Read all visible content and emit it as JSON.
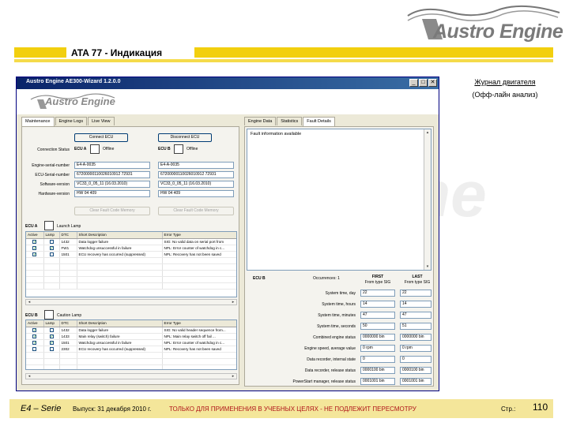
{
  "brand": {
    "logo": "Austro Engine",
    "watermark": "ne"
  },
  "page_title": "ATA 77 - Индикация",
  "side_note": {
    "line1": "Журнал двигателя",
    "line2": "(Офф-лайн анализ)"
  },
  "footer": {
    "series": "E4 – Serie",
    "issue": "Выпуск: 31 декабря 2010 г.",
    "warning": "ТОЛЬКО ДЛЯ ПРИМЕНЕНИЯ В УЧЕБНЫХ ЦЕЛЯХ - НЕ ПОДЛЕЖИТ ПЕРЕСМОТРУ",
    "page_label": "Стр.:",
    "page_number": "110"
  },
  "window": {
    "title": "Austro Engine AE300-Wizard 1.2.0.0",
    "banner_logo": "Austro Engine",
    "controls": {
      "minimize": "_",
      "maximize": "□",
      "close": "✕"
    },
    "left_tabs": [
      "Maintenance",
      "Engine Logs",
      "Live View"
    ],
    "right_tabs": [
      "Engine Data",
      "Statistics",
      "Fault Details"
    ],
    "connect_a": "Connect ECU",
    "connect_b": "Disconnect ECU",
    "connection_status_label": "Connection Status",
    "ecu_a": {
      "name": "ECU A",
      "status": "Offline"
    },
    "ecu_b": {
      "name": "ECU B",
      "status": "Offline"
    },
    "fields": [
      {
        "label": "Engine-serial-number",
        "a": "E4-A-0035",
        "b": "E4-A-0035"
      },
      {
        "label": "ECU-Serial-number",
        "a": "67200000110026010912 72931",
        "b": "67200000110026010912 72931"
      },
      {
        "label": "Software-version",
        "a": "VC33_0_05_11 (16.03.2010)",
        "b": "VC33_0_05_11 (16.03.2010)"
      },
      {
        "label": "Hardware-version",
        "a": "HW 04 409",
        "b": "HW 04 409"
      }
    ],
    "clear_a": "Clear Fault Code Memory",
    "clear_b": "Clear Fault Code Memory",
    "launch_lamp": {
      "ecu": "ECU A",
      "label": "Launch Lamp"
    },
    "caution_lamp": {
      "ecu": "ECU B",
      "label": "Caution Lamp"
    },
    "fault_columns": [
      "Active",
      "Lamp",
      "DTC",
      "Short Description",
      "Error Type"
    ],
    "faults_top": [
      {
        "active": true,
        "lamp": false,
        "dtc": "1432",
        "desc": "Data logger failure",
        "err": "SIG: No valid data on serial port from"
      },
      {
        "active": true,
        "lamp": true,
        "dtc": "FW1",
        "desc": "Watchdog unsuccessful in failure",
        "err": "NPL: Error counter of watchdog in c..."
      },
      {
        "active": true,
        "lamp": false,
        "dtc": "1501",
        "desc": "ECU recovery has occurred (suppressed)",
        "err": "NPL: Recovery has not been saved"
      }
    ],
    "faults_bottom": [
      {
        "active": true,
        "lamp": false,
        "dtc": "1432",
        "desc": "Data logger failure",
        "err": "SIG: No valid header sequence from..."
      },
      {
        "active": true,
        "lamp": true,
        "dtc": "1433",
        "desc": "Main relay (switch) failure",
        "err": "NPL: Main relay switch off fail ..."
      },
      {
        "active": true,
        "lamp": true,
        "dtc": "1501",
        "desc": "Watchdog unsuccessful in failure",
        "err": "NPL: Error counter of watchdog in c..."
      },
      {
        "active": false,
        "lamp": false,
        "dtc": "2302",
        "desc": "ECU recovery has occurred (suppressed)",
        "err": "NPL: Recovery has not been saved"
      }
    ],
    "fault_info": "Fault information available",
    "details": {
      "ecu": "ECU B",
      "occurrences_label": "Occurrences: 1",
      "first_label": "FIRST",
      "first_sub": "From type SIG",
      "last_label": "LAST",
      "last_sub": "From type SIG",
      "rows": [
        {
          "label": "System time, day",
          "first": "22",
          "last": "22"
        },
        {
          "label": "System time, hours",
          "first": "14",
          "last": "14"
        },
        {
          "label": "System time, minutes",
          "first": "47",
          "last": "47"
        },
        {
          "label": "System time, seconds",
          "first": "50",
          "last": "51"
        },
        {
          "label": "Combined engine status",
          "first": "0000000 bin",
          "last": "0000000 bin"
        },
        {
          "label": "Engine speed, average value",
          "first": "0 rpm",
          "last": "0 rpm"
        },
        {
          "label": "Data recorder, internal state",
          "first": "0",
          "last": "0"
        },
        {
          "label": "Data recorder, release status",
          "first": "0000100 bin",
          "last": "0000100 bin"
        },
        {
          "label": "PowerStart manager, release status",
          "first": "0001001 bin",
          "last": "0001001 bin"
        }
      ]
    }
  },
  "colors": {
    "accent_yellow": "#f2cf0e",
    "footer_band": "#f4e69a",
    "warning_red": "#b0161a",
    "titlebar": "#0a246a"
  }
}
